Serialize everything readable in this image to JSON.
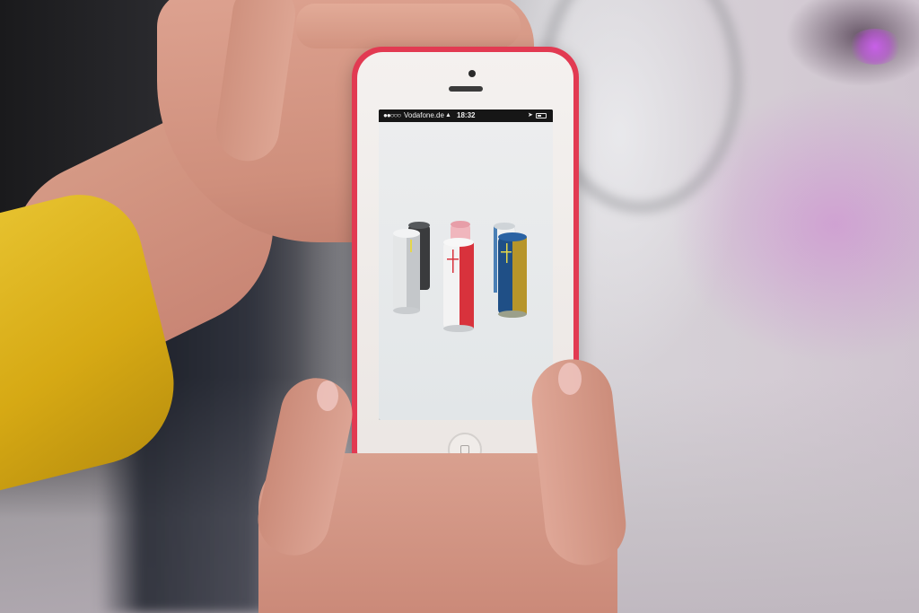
{
  "phone": {
    "carrier": "Vodafone.de",
    "time": "18:32",
    "signal_glyph": "●●○○○",
    "wifi_icon": "wifi-icon",
    "location_icon": "location-arrow-icon",
    "battery_level": 0.55,
    "case_color": "#e23a52"
  },
  "app": {
    "content": "speaker-product-lineup",
    "products": [
      {
        "name": "speaker-gray-back",
        "colors": [
          "#3a3b3d",
          "#55585b"
        ]
      },
      {
        "name": "speaker-pink-back",
        "colors": [
          "#f0b6bd",
          "#e79ea8"
        ]
      },
      {
        "name": "speaker-white-back",
        "colors": [
          "#f0f1f2",
          "#cfd4d8"
        ]
      },
      {
        "name": "speaker-white-front",
        "colors": [
          "#e4e6e7",
          "#c4c7ca"
        ],
        "accent": "#e6d74a"
      },
      {
        "name": "speaker-red-white-front",
        "colors": [
          "#f3f3f3",
          "#d8323c"
        ]
      },
      {
        "name": "speaker-blue-yellow-front",
        "colors": [
          "#1f4f86",
          "#b7952a"
        ]
      }
    ]
  }
}
